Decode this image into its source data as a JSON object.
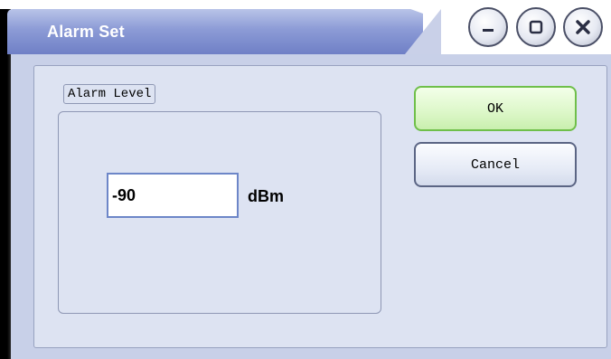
{
  "window": {
    "title": "Alarm Set",
    "controls": {
      "minimize_icon": "minimize-icon",
      "maximize_icon": "maximize-icon",
      "close_icon": "close-icon"
    }
  },
  "alarm_level_group": {
    "legend": "Alarm Level",
    "value": "-90",
    "unit": "dBm"
  },
  "buttons": {
    "ok_label": "OK",
    "cancel_label": "Cancel"
  },
  "colors": {
    "title_bar": "#8c9bd6",
    "panel_bg": "#dde3f2",
    "ok_border": "#6fbf4a"
  }
}
